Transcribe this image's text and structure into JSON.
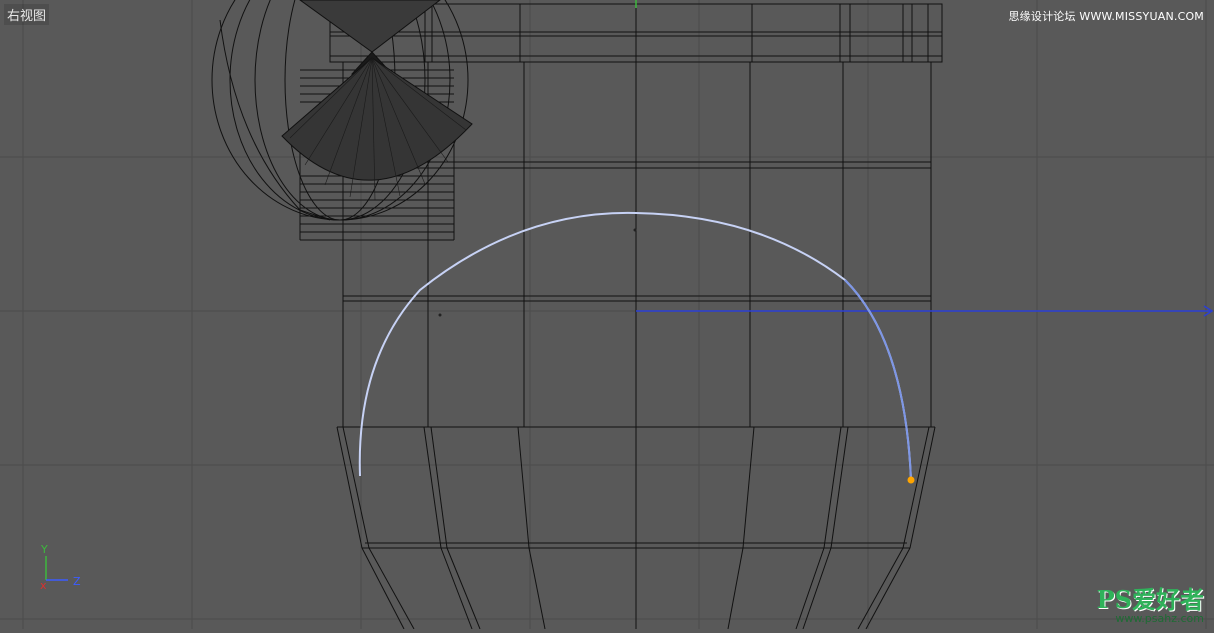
{
  "viewport": {
    "label": "右视图",
    "background": "#595959",
    "grid_color": "#4a4a4a",
    "wire_color": "#111111",
    "spline_color": "#c7d2f5",
    "spline_end_color": "#7d96e6",
    "point_color": "#ffa500",
    "axis_z_color": "#2b3fd6"
  },
  "axis_gizmo": {
    "y": "Y",
    "z": "Z"
  },
  "watermark": {
    "top": "思缘设计论坛 WWW.MISSYUAN.COM",
    "logo": "PS爱好者",
    "url": "www.psahz.com"
  }
}
